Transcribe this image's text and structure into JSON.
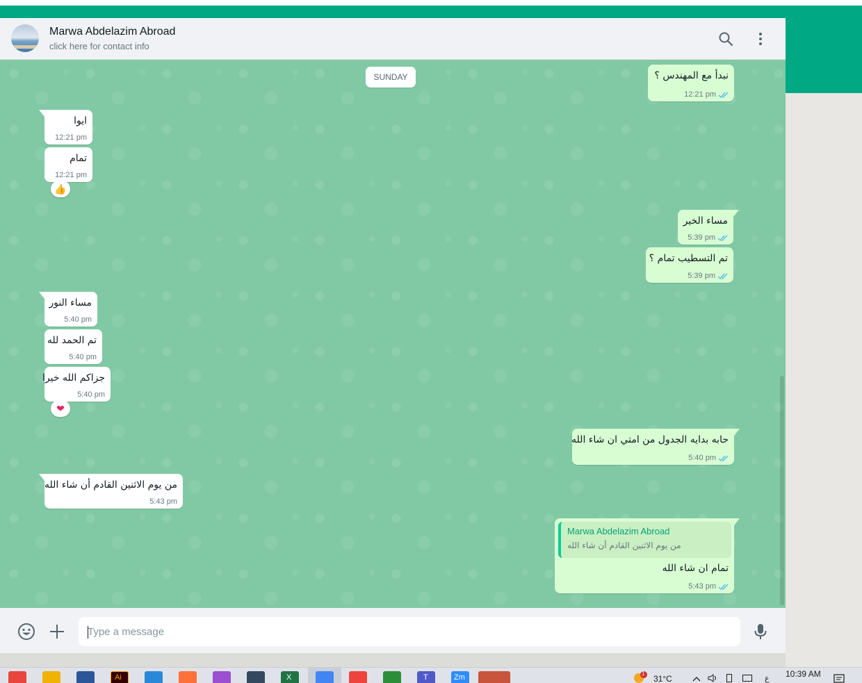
{
  "header": {
    "contact_name": "Marwa Abdelazim Abroad",
    "subtitle": "click here for contact info",
    "icons": [
      "search-icon",
      "menu-dots-icon"
    ]
  },
  "chat": {
    "day_label": "SUNDAY",
    "messages": [
      {
        "id": "m1",
        "direction": "out",
        "text": "نبدأ مع المهندس ؟",
        "time": "12:21 pm",
        "status": "read"
      },
      {
        "id": "m2",
        "direction": "in",
        "text": "ايوا",
        "time": "12:21 pm"
      },
      {
        "id": "m3",
        "direction": "in",
        "text": "تمام",
        "time": "12:21 pm",
        "reaction": "👍"
      },
      {
        "id": "m4",
        "direction": "out",
        "text": "مساء الخير",
        "time": "5:39 pm",
        "status": "read"
      },
      {
        "id": "m5",
        "direction": "out",
        "text": "تم التسطيب تمام ؟",
        "time": "5:39 pm",
        "status": "read"
      },
      {
        "id": "m6",
        "direction": "in",
        "text": "مساء النور",
        "time": "5:40 pm"
      },
      {
        "id": "m7",
        "direction": "in",
        "text": "تم الحمد لله",
        "time": "5:40 pm"
      },
      {
        "id": "m8",
        "direction": "in",
        "text": "جزاكم الله خيرا",
        "time": "5:40 pm",
        "reaction": "❤"
      },
      {
        "id": "m9",
        "direction": "out",
        "text": "حابه بدايه الجدول من امتي ان شاء الله",
        "time": "5:40 pm",
        "status": "read"
      },
      {
        "id": "m10",
        "direction": "in",
        "text": "من يوم الاثنين القادم أن شاء الله",
        "time": "5:43 pm"
      },
      {
        "id": "m11",
        "direction": "out",
        "text": "تمام ان شاء الله",
        "time": "5:43 pm",
        "status": "read",
        "quote": {
          "author": "Marwa Abdelazim Abroad",
          "text": "من يوم الاثنين القادم أن شاء الله"
        }
      }
    ]
  },
  "composer": {
    "placeholder": "Type a message",
    "icons": [
      "emoji-icon",
      "attach-plus-icon",
      "microphone-icon"
    ]
  },
  "taskbar": {
    "weather": "31°C",
    "clock": "10:39 AM",
    "weather_badge": "1",
    "lang_indicator": "ع",
    "app_labels": [
      "Ai",
      "X",
      "T",
      "Zm"
    ],
    "apps": [
      "chrome-icon",
      "chrome-alt-icon",
      "word-icon",
      "illustrator-icon",
      "photos-icon",
      "firefox-icon",
      "affinity-icon",
      "editor-icon",
      "excel-icon",
      "chrome-active-icon",
      "anydesk-icon",
      "paint-icon",
      "teams-icon",
      "zoom-icon",
      "acrobat-icon"
    ]
  },
  "colors": {
    "brand_green": "#00a884",
    "chat_wallpaper": "#80c9a4",
    "outgoing_bubble": "#d9fdd3",
    "incoming_bubble": "#ffffff",
    "read_ticks": "#53bdeb"
  }
}
